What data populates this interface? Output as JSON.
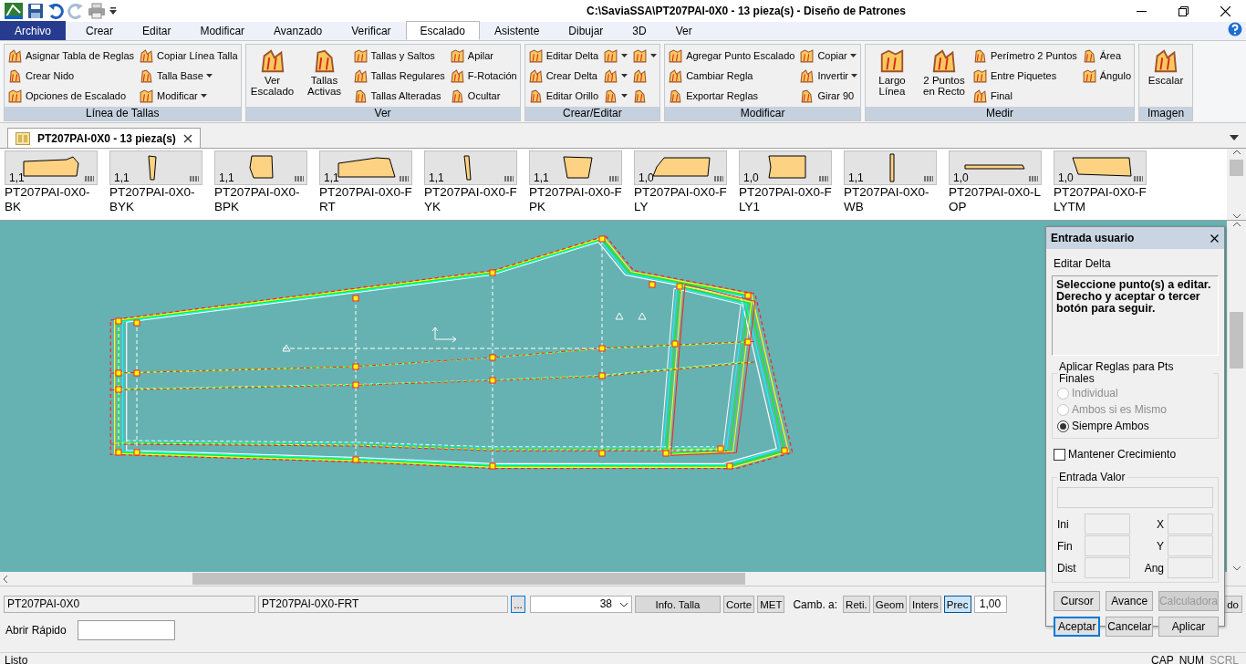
{
  "window": {
    "title": "C:\\SaviaSSA\\PT207PAI-0X0  -  13 pieza(s) - Diseño de Patrones"
  },
  "menu_tabs": [
    {
      "label": "Archivo",
      "kind": "file",
      "selected": false
    },
    {
      "label": "Crear",
      "selected": false
    },
    {
      "label": "Editar",
      "selected": false
    },
    {
      "label": "Modificar",
      "selected": false
    },
    {
      "label": "Avanzado",
      "selected": false
    },
    {
      "label": "Verificar",
      "selected": false
    },
    {
      "label": "Escalado",
      "selected": true
    },
    {
      "label": "Asistente",
      "selected": false
    },
    {
      "label": "Dibujar",
      "selected": false
    },
    {
      "label": "3D",
      "selected": false
    },
    {
      "label": "Ver",
      "selected": false
    }
  ],
  "ribbon_groups": [
    {
      "label": "Línea de Tallas",
      "columns": [
        [
          {
            "kind": "small",
            "label": "Asignar Tabla de Reglas"
          },
          {
            "kind": "small",
            "label": "Crear Nido"
          },
          {
            "kind": "small",
            "label": "Opciones de Escalado"
          }
        ],
        [
          {
            "kind": "small",
            "label": "Copiar Línea Talla"
          },
          {
            "kind": "small",
            "label": "Talla Base",
            "dropdown": true
          },
          {
            "kind": "small",
            "label": "Modificar",
            "dropdown": true
          }
        ]
      ]
    },
    {
      "label": "Ver",
      "columns": [
        [
          {
            "kind": "large",
            "label": "Ver Escalado"
          }
        ],
        [
          {
            "kind": "large",
            "label": "Tallas Activas"
          }
        ],
        [
          {
            "kind": "small",
            "label": "Tallas y Saltos"
          },
          {
            "kind": "small",
            "label": "Tallas Regulares"
          },
          {
            "kind": "small",
            "label": "Tallas Alteradas"
          }
        ],
        [
          {
            "kind": "small",
            "label": "Apilar"
          },
          {
            "kind": "small",
            "label": "F-Rotación"
          },
          {
            "kind": "small",
            "label": "Ocultar"
          }
        ]
      ]
    },
    {
      "label": "Crear/Editar",
      "columns": [
        [
          {
            "kind": "small",
            "label": "Editar Delta"
          },
          {
            "kind": "small",
            "label": "Crear Delta"
          },
          {
            "kind": "small",
            "label": "Editar Orillo"
          }
        ],
        [
          {
            "kind": "icon",
            "dropdown": true
          },
          {
            "kind": "icon",
            "dropdown": true
          },
          {
            "kind": "icon",
            "dropdown": true
          }
        ],
        [
          {
            "kind": "icon",
            "dropdown": true
          },
          {
            "kind": "icon"
          },
          {
            "kind": "icon"
          }
        ]
      ]
    },
    {
      "label": "Modificar",
      "columns": [
        [
          {
            "kind": "small",
            "label": "Agregar Punto Escalado"
          },
          {
            "kind": "small",
            "label": "Cambiar Regla"
          },
          {
            "kind": "small",
            "label": "Exportar Reglas"
          }
        ],
        [
          {
            "kind": "small",
            "label": "Copiar",
            "dropdown": true
          },
          {
            "kind": "small",
            "label": "Invertir",
            "dropdown": true
          },
          {
            "kind": "small",
            "label": "Girar 90"
          }
        ]
      ]
    },
    {
      "label": "Medir",
      "columns": [
        [
          {
            "kind": "large",
            "label": "Largo Línea"
          }
        ],
        [
          {
            "kind": "large",
            "label": "2 Puntos en Recto"
          }
        ],
        [
          {
            "kind": "small",
            "label": "Perímetro 2 Puntos"
          },
          {
            "kind": "small",
            "label": "Entre Piquetes"
          },
          {
            "kind": "small",
            "label": "Final"
          }
        ],
        [
          {
            "kind": "small",
            "label": "Área"
          },
          {
            "kind": "small",
            "label": "Ángulo"
          }
        ]
      ]
    },
    {
      "label": "Imagen",
      "columns": [
        [
          {
            "kind": "large",
            "label": "Escalar"
          }
        ]
      ]
    }
  ],
  "document_tab": {
    "label": "PT207PAI-0X0  -  13 pieza(s)"
  },
  "pieces": [
    {
      "scale": "1,1",
      "name": "PT207PAI-0X0-BK"
    },
    {
      "scale": "1,1",
      "name": "PT207PAI-0X0-BYK"
    },
    {
      "scale": "1,1",
      "name": "PT207PAI-0X0-BPK"
    },
    {
      "scale": "1,1",
      "name": "PT207PAI-0X0-FRT"
    },
    {
      "scale": "1,1",
      "name": "PT207PAI-0X0-FYK"
    },
    {
      "scale": "1,1",
      "name": "PT207PAI-0X0-FPK"
    },
    {
      "scale": "1,0",
      "name": "PT207PAI-0X0-FLY"
    },
    {
      "scale": "1,0",
      "name": "PT207PAI-0X0-FLY1"
    },
    {
      "scale": "1,1",
      "name": "PT207PAI-0X0-WB"
    },
    {
      "scale": "1,0",
      "name": "PT207PAI-0X0-LOP"
    },
    {
      "scale": "1,0",
      "name": "PT207PAI-0X0-FLYTM"
    }
  ],
  "user_input_panel": {
    "title": "Entrada usuario",
    "command": "Editar Delta",
    "message": "Seleccione punto(s) a editar. Derecho y aceptar o tercer botón para seguir.",
    "rules_group": {
      "label": "Aplicar Reglas para Pts Finales",
      "options": [
        {
          "label": "Individual",
          "selected": false,
          "disabled": true
        },
        {
          "label": "Ambos si es Mismo",
          "selected": false,
          "disabled": true
        },
        {
          "label": "Siempre Ambos",
          "selected": true,
          "disabled": false
        }
      ]
    },
    "keep_growth": {
      "label": "Mantener Crecimiento",
      "checked": false
    },
    "value_group": {
      "label": "Entrada Valor",
      "fields": [
        {
          "label": "Ini"
        },
        {
          "label": "X"
        },
        {
          "label": "Fin"
        },
        {
          "label": "Y"
        },
        {
          "label": "Dist"
        },
        {
          "label": "Ang"
        }
      ]
    },
    "buttons": [
      {
        "label": "Cursor",
        "disabled": false,
        "default": false
      },
      {
        "label": "Avance",
        "disabled": false,
        "default": false
      },
      {
        "label": "Calculadora",
        "disabled": true,
        "default": false
      },
      {
        "label": "Aceptar",
        "disabled": false,
        "default": true
      },
      {
        "label": "Cancelar",
        "disabled": false,
        "default": false
      },
      {
        "label": "Aplicar",
        "disabled": false,
        "default": false
      }
    ]
  },
  "bottom_bar": {
    "style_field": "PT207PAI-0X0",
    "piece_field": "PT207PAI-0X0-FRT",
    "browse_button": "...",
    "size_select": "38",
    "buttons": [
      {
        "label": "Info. Talla",
        "kind": "wide"
      },
      {
        "label": "Corte"
      },
      {
        "label": "MET"
      }
    ],
    "change_label": "Camb. a:",
    "modes": [
      {
        "label": "Reti.",
        "selected": false
      },
      {
        "label": "Geom",
        "selected": false
      },
      {
        "label": "Inters",
        "selected": false
      },
      {
        "label": "Prec",
        "selected": true
      }
    ],
    "precision_field": "1,00",
    "cut_button": "do",
    "quick_open_label": "Abrir Rápido"
  },
  "status_bar": {
    "text": "Listo",
    "indicators": [
      {
        "label": "CAP",
        "disabled": false
      },
      {
        "label": "NUM",
        "disabled": false
      },
      {
        "label": "SCRL",
        "disabled": true
      }
    ]
  }
}
